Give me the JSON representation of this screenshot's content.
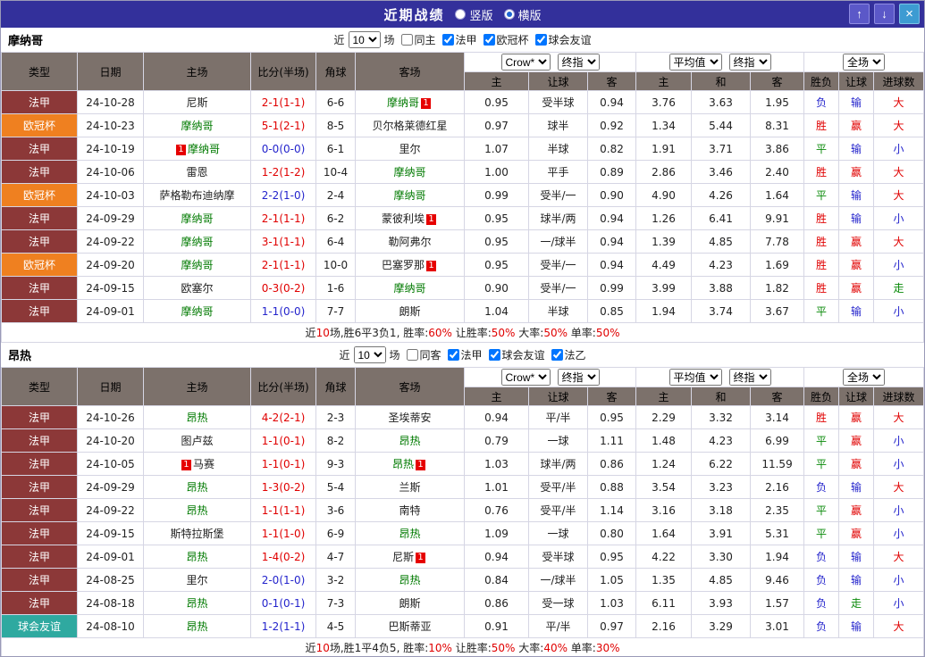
{
  "titlebar": {
    "title": "近期战绩",
    "radios": [
      {
        "label": "竖版",
        "selected": false
      },
      {
        "label": "横版",
        "selected": true
      }
    ],
    "buttons": {
      "up": "↑",
      "down": "↓",
      "close": "×"
    }
  },
  "palette": {
    "red": "#e00000",
    "blue": "#2424cc",
    "green": "#0a8a0a",
    "black": "#222222",
    "team_green": "#007a00"
  },
  "league_colors": {
    "法甲": "#8c3838",
    "欧冠杯": "#ef8020",
    "球会友谊": "#2fa9a0"
  },
  "table_headers": {
    "left": [
      "类型",
      "日期",
      "主场",
      "比分(半场)",
      "角球",
      "客场"
    ],
    "right": [
      "主",
      "让球",
      "客",
      "主",
      "和",
      "客",
      "胜负",
      "让球",
      "进球数"
    ]
  },
  "sections": [
    {
      "team": "摩纳哥",
      "filter": {
        "near": "近",
        "count": "10",
        "unit": "场",
        "checkboxes": [
          {
            "label": "同主",
            "checked": false
          },
          {
            "label": "法甲",
            "checked": true
          },
          {
            "label": "欧冠杯",
            "checked": true
          },
          {
            "label": "球会友谊",
            "checked": true
          }
        ]
      },
      "dropdown_groups": [
        [
          "Crow*",
          "终指"
        ],
        [
          "平均值",
          "终指"
        ],
        [
          "全场"
        ]
      ],
      "rows": [
        {
          "type": "法甲",
          "date": "24-10-28",
          "home": {
            "name": "尼斯",
            "self": false
          },
          "score": "2-1(1-1)",
          "score_color": "red",
          "corners": "6-6",
          "away": {
            "name": "摩纳哥",
            "self": true,
            "badge_after": "1"
          },
          "odds": [
            "0.95",
            "受半球",
            "0.94",
            "3.76",
            "3.63",
            "1.95"
          ],
          "results": [
            [
              "负",
              "blue"
            ],
            [
              "输",
              "blue"
            ],
            [
              "大",
              "red"
            ]
          ]
        },
        {
          "type": "欧冠杯",
          "date": "24-10-23",
          "home": {
            "name": "摩纳哥",
            "self": true
          },
          "score": "5-1(2-1)",
          "score_color": "red",
          "corners": "8-5",
          "away": {
            "name": "贝尔格莱德红星",
            "self": false
          },
          "odds": [
            "0.97",
            "球半",
            "0.92",
            "1.34",
            "5.44",
            "8.31"
          ],
          "results": [
            [
              "胜",
              "red"
            ],
            [
              "赢",
              "red"
            ],
            [
              "大",
              "red"
            ]
          ]
        },
        {
          "type": "法甲",
          "date": "24-10-19",
          "home": {
            "name": "摩纳哥",
            "self": true,
            "badge_before": "1"
          },
          "score": "0-0(0-0)",
          "score_color": "blue",
          "corners": "6-1",
          "away": {
            "name": "里尔",
            "self": false
          },
          "odds": [
            "1.07",
            "半球",
            "0.82",
            "1.91",
            "3.71",
            "3.86"
          ],
          "results": [
            [
              "平",
              "green"
            ],
            [
              "输",
              "blue"
            ],
            [
              "小",
              "blue"
            ]
          ]
        },
        {
          "type": "法甲",
          "date": "24-10-06",
          "home": {
            "name": "雷恩",
            "self": false
          },
          "score": "1-2(1-2)",
          "score_color": "red",
          "corners": "10-4",
          "away": {
            "name": "摩纳哥",
            "self": true
          },
          "odds": [
            "1.00",
            "平手",
            "0.89",
            "2.86",
            "3.46",
            "2.40"
          ],
          "results": [
            [
              "胜",
              "red"
            ],
            [
              "赢",
              "red"
            ],
            [
              "大",
              "red"
            ]
          ]
        },
        {
          "type": "欧冠杯",
          "date": "24-10-03",
          "home": {
            "name": "萨格勒布迪纳摩",
            "self": false
          },
          "score": "2-2(1-0)",
          "score_color": "blue",
          "corners": "2-4",
          "away": {
            "name": "摩纳哥",
            "self": true
          },
          "odds": [
            "0.99",
            "受半/一",
            "0.90",
            "4.90",
            "4.26",
            "1.64"
          ],
          "results": [
            [
              "平",
              "green"
            ],
            [
              "输",
              "blue"
            ],
            [
              "大",
              "red"
            ]
          ]
        },
        {
          "type": "法甲",
          "date": "24-09-29",
          "home": {
            "name": "摩纳哥",
            "self": true
          },
          "score": "2-1(1-1)",
          "score_color": "red",
          "corners": "6-2",
          "away": {
            "name": "蒙彼利埃",
            "self": false,
            "badge_after": "1"
          },
          "odds": [
            "0.95",
            "球半/两",
            "0.94",
            "1.26",
            "6.41",
            "9.91"
          ],
          "results": [
            [
              "胜",
              "red"
            ],
            [
              "输",
              "blue"
            ],
            [
              "小",
              "blue"
            ]
          ]
        },
        {
          "type": "法甲",
          "date": "24-09-22",
          "home": {
            "name": "摩纳哥",
            "self": true
          },
          "score": "3-1(1-1)",
          "score_color": "red",
          "corners": "6-4",
          "away": {
            "name": "勒阿弗尔",
            "self": false
          },
          "odds": [
            "0.95",
            "一/球半",
            "0.94",
            "1.39",
            "4.85",
            "7.78"
          ],
          "results": [
            [
              "胜",
              "red"
            ],
            [
              "赢",
              "red"
            ],
            [
              "大",
              "red"
            ]
          ]
        },
        {
          "type": "欧冠杯",
          "date": "24-09-20",
          "home": {
            "name": "摩纳哥",
            "self": true
          },
          "score": "2-1(1-1)",
          "score_color": "red",
          "corners": "10-0",
          "away": {
            "name": "巴塞罗那",
            "self": false,
            "badge_after": "1"
          },
          "odds": [
            "0.95",
            "受半/一",
            "0.94",
            "4.49",
            "4.23",
            "1.69"
          ],
          "results": [
            [
              "胜",
              "red"
            ],
            [
              "赢",
              "red"
            ],
            [
              "小",
              "blue"
            ]
          ]
        },
        {
          "type": "法甲",
          "date": "24-09-15",
          "home": {
            "name": "欧塞尔",
            "self": false
          },
          "score": "0-3(0-2)",
          "score_color": "red",
          "corners": "1-6",
          "away": {
            "name": "摩纳哥",
            "self": true
          },
          "odds": [
            "0.90",
            "受半/一",
            "0.99",
            "3.99",
            "3.88",
            "1.82"
          ],
          "results": [
            [
              "胜",
              "red"
            ],
            [
              "赢",
              "red"
            ],
            [
              "走",
              "green"
            ]
          ]
        },
        {
          "type": "法甲",
          "date": "24-09-01",
          "home": {
            "name": "摩纳哥",
            "self": true
          },
          "score": "1-1(0-0)",
          "score_color": "blue",
          "corners": "7-7",
          "away": {
            "name": "朗斯",
            "self": false
          },
          "odds": [
            "1.04",
            "半球",
            "0.85",
            "1.94",
            "3.74",
            "3.67"
          ],
          "results": [
            [
              "平",
              "green"
            ],
            [
              "输",
              "blue"
            ],
            [
              "小",
              "blue"
            ]
          ]
        }
      ],
      "summary": [
        [
          "近",
          "black"
        ],
        [
          "10",
          "red"
        ],
        [
          "场,胜6平3负1, 胜率:",
          "black"
        ],
        [
          "60%",
          "red"
        ],
        [
          " 让胜率:",
          "black"
        ],
        [
          "50%",
          "red"
        ],
        [
          " 大率:",
          "black"
        ],
        [
          "50%",
          "red"
        ],
        [
          " 单率:",
          "black"
        ],
        [
          "50%",
          "red"
        ]
      ]
    },
    {
      "team": "昂热",
      "filter": {
        "near": "近",
        "count": "10",
        "unit": "场",
        "checkboxes": [
          {
            "label": "同客",
            "checked": false
          },
          {
            "label": "法甲",
            "checked": true
          },
          {
            "label": "球会友谊",
            "checked": true
          },
          {
            "label": "法乙",
            "checked": true
          }
        ]
      },
      "dropdown_groups": [
        [
          "Crow*",
          "终指"
        ],
        [
          "平均值",
          "终指"
        ],
        [
          "全场"
        ]
      ],
      "rows": [
        {
          "type": "法甲",
          "date": "24-10-26",
          "home": {
            "name": "昂热",
            "self": true
          },
          "score": "4-2(2-1)",
          "score_color": "red",
          "corners": "2-3",
          "away": {
            "name": "圣埃蒂安",
            "self": false
          },
          "odds": [
            "0.94",
            "平/半",
            "0.95",
            "2.29",
            "3.32",
            "3.14"
          ],
          "results": [
            [
              "胜",
              "red"
            ],
            [
              "赢",
              "red"
            ],
            [
              "大",
              "red"
            ]
          ]
        },
        {
          "type": "法甲",
          "date": "24-10-20",
          "home": {
            "name": "图卢兹",
            "self": false
          },
          "score": "1-1(0-1)",
          "score_color": "red",
          "corners": "8-2",
          "away": {
            "name": "昂热",
            "self": true
          },
          "odds": [
            "0.79",
            "一球",
            "1.11",
            "1.48",
            "4.23",
            "6.99"
          ],
          "results": [
            [
              "平",
              "green"
            ],
            [
              "赢",
              "red"
            ],
            [
              "小",
              "blue"
            ]
          ]
        },
        {
          "type": "法甲",
          "date": "24-10-05",
          "home": {
            "name": "马赛",
            "self": false,
            "badge_before": "1"
          },
          "score": "1-1(0-1)",
          "score_color": "red",
          "corners": "9-3",
          "away": {
            "name": "昂热",
            "self": true,
            "badge_after": "1"
          },
          "odds": [
            "1.03",
            "球半/两",
            "0.86",
            "1.24",
            "6.22",
            "11.59"
          ],
          "results": [
            [
              "平",
              "green"
            ],
            [
              "赢",
              "red"
            ],
            [
              "小",
              "blue"
            ]
          ]
        },
        {
          "type": "法甲",
          "date": "24-09-29",
          "home": {
            "name": "昂热",
            "self": true
          },
          "score": "1-3(0-2)",
          "score_color": "red",
          "corners": "5-4",
          "away": {
            "name": "兰斯",
            "self": false
          },
          "odds": [
            "1.01",
            "受平/半",
            "0.88",
            "3.54",
            "3.23",
            "2.16"
          ],
          "results": [
            [
              "负",
              "blue"
            ],
            [
              "输",
              "blue"
            ],
            [
              "大",
              "red"
            ]
          ]
        },
        {
          "type": "法甲",
          "date": "24-09-22",
          "home": {
            "name": "昂热",
            "self": true
          },
          "score": "1-1(1-1)",
          "score_color": "red",
          "corners": "3-6",
          "away": {
            "name": "南特",
            "self": false
          },
          "odds": [
            "0.76",
            "受平/半",
            "1.14",
            "3.16",
            "3.18",
            "2.35"
          ],
          "results": [
            [
              "平",
              "green"
            ],
            [
              "赢",
              "red"
            ],
            [
              "小",
              "blue"
            ]
          ]
        },
        {
          "type": "法甲",
          "date": "24-09-15",
          "home": {
            "name": "斯特拉斯堡",
            "self": false
          },
          "score": "1-1(1-0)",
          "score_color": "red",
          "corners": "6-9",
          "away": {
            "name": "昂热",
            "self": true
          },
          "odds": [
            "1.09",
            "一球",
            "0.80",
            "1.64",
            "3.91",
            "5.31"
          ],
          "results": [
            [
              "平",
              "green"
            ],
            [
              "赢",
              "red"
            ],
            [
              "小",
              "blue"
            ]
          ]
        },
        {
          "type": "法甲",
          "date": "24-09-01",
          "home": {
            "name": "昂热",
            "self": true
          },
          "score": "1-4(0-2)",
          "score_color": "red",
          "corners": "4-7",
          "away": {
            "name": "尼斯",
            "self": false,
            "badge_after": "1"
          },
          "odds": [
            "0.94",
            "受半球",
            "0.95",
            "4.22",
            "3.30",
            "1.94"
          ],
          "results": [
            [
              "负",
              "blue"
            ],
            [
              "输",
              "blue"
            ],
            [
              "大",
              "red"
            ]
          ]
        },
        {
          "type": "法甲",
          "date": "24-08-25",
          "home": {
            "name": "里尔",
            "self": false
          },
          "score": "2-0(1-0)",
          "score_color": "blue",
          "corners": "3-2",
          "away": {
            "name": "昂热",
            "self": true
          },
          "odds": [
            "0.84",
            "一/球半",
            "1.05",
            "1.35",
            "4.85",
            "9.46"
          ],
          "results": [
            [
              "负",
              "blue"
            ],
            [
              "输",
              "blue"
            ],
            [
              "小",
              "blue"
            ]
          ]
        },
        {
          "type": "法甲",
          "date": "24-08-18",
          "home": {
            "name": "昂热",
            "self": true
          },
          "score": "0-1(0-1)",
          "score_color": "blue",
          "corners": "7-3",
          "away": {
            "name": "朗斯",
            "self": false
          },
          "odds": [
            "0.86",
            "受一球",
            "1.03",
            "6.11",
            "3.93",
            "1.57"
          ],
          "results": [
            [
              "负",
              "blue"
            ],
            [
              "走",
              "green"
            ],
            [
              "小",
              "blue"
            ]
          ]
        },
        {
          "type": "球会友谊",
          "date": "24-08-10",
          "home": {
            "name": "昂热",
            "self": true
          },
          "score": "1-2(1-1)",
          "score_color": "blue",
          "corners": "4-5",
          "away": {
            "name": "巴斯蒂亚",
            "self": false
          },
          "odds": [
            "0.91",
            "平/半",
            "0.97",
            "2.16",
            "3.29",
            "3.01"
          ],
          "results": [
            [
              "负",
              "blue"
            ],
            [
              "输",
              "blue"
            ],
            [
              "大",
              "red"
            ]
          ]
        }
      ],
      "summary": [
        [
          "近",
          "black"
        ],
        [
          "10",
          "red"
        ],
        [
          "场,胜1平4负5, 胜率:",
          "black"
        ],
        [
          "10%",
          "red"
        ],
        [
          " 让胜率:",
          "black"
        ],
        [
          "50%",
          "red"
        ],
        [
          " 大率:",
          "black"
        ],
        [
          "40%",
          "red"
        ],
        [
          " 单率:",
          "black"
        ],
        [
          "30%",
          "red"
        ]
      ]
    }
  ]
}
